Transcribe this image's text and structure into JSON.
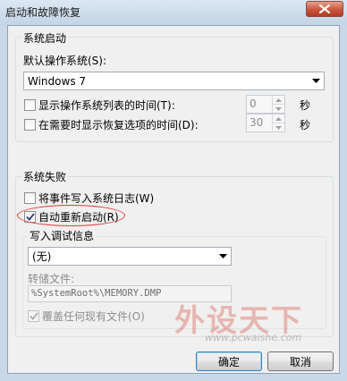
{
  "window": {
    "title": "启动和故障恢复"
  },
  "system_startup": {
    "group_label": "系统启动",
    "default_os_label": "默认操作系统(S):",
    "default_os_value": "Windows 7",
    "show_os_list_label": "显示操作系统列表的时间(T):",
    "show_os_list_value": "0",
    "show_recovery_label": "在需要时显示恢复选项的时间(D):",
    "show_recovery_value": "30",
    "seconds_unit": "秒"
  },
  "system_failure": {
    "group_label": "系统失败",
    "write_event_label": "将事件写入系统日志(W)",
    "write_event_checked": false,
    "auto_restart_label": "自动重新启动(R)",
    "auto_restart_checked": true,
    "debug_info_label": "写入调试信息",
    "debug_info_value": "(无)",
    "dump_file_label": "转储文件:",
    "dump_file_value": "%SystemRoot%\\MEMORY.DMP",
    "overwrite_label": "覆盖任何现有文件(O)",
    "overwrite_checked": true
  },
  "buttons": {
    "ok": "确定",
    "cancel": "取消"
  },
  "watermark": {
    "text": "外设天下",
    "url": "www.pcwaishe.com"
  },
  "colors": {
    "highlight_oval": "#e03a3a",
    "close_button": "#c8553d"
  },
  "icons": {
    "close": "close-icon",
    "dropdown": "chevron-down-icon",
    "check": "checkmark-icon"
  }
}
